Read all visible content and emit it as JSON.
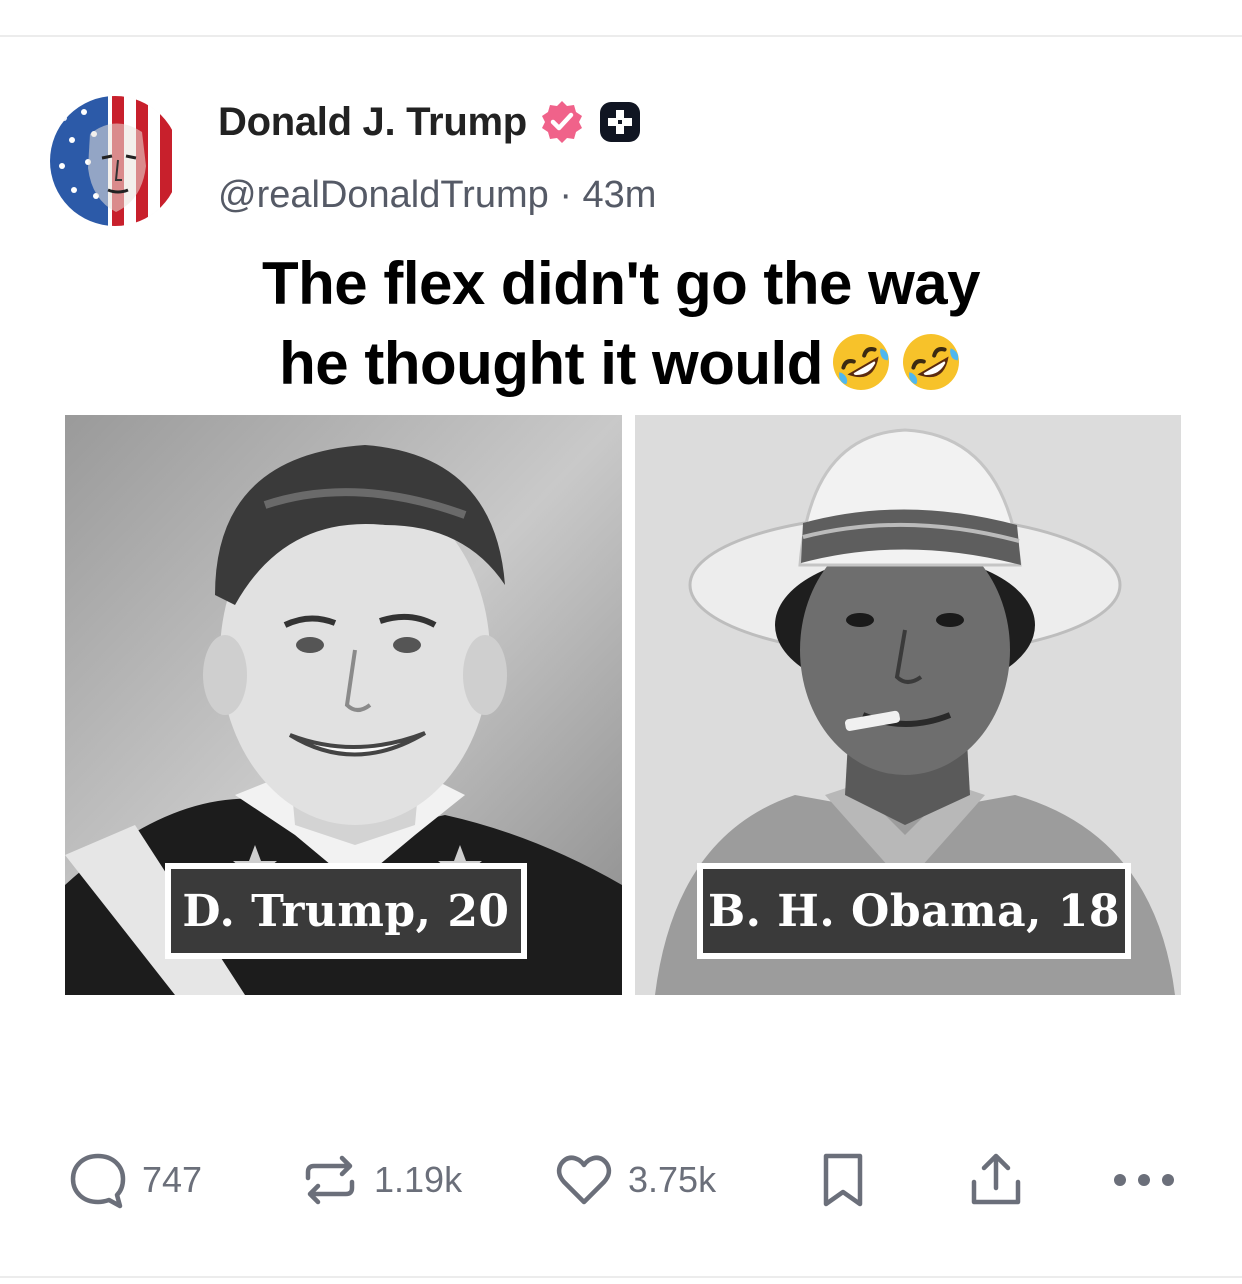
{
  "post": {
    "author": {
      "display_name": "Donald J. Trump",
      "handle": "@realDonaldTrump",
      "separator": "·",
      "time_ago": "43m",
      "avatar_icon": "flag-portrait-avatar",
      "verified_icon": "verified-badge-icon",
      "badge_icon": "plus-badge-icon",
      "verified_color": "#f0628a"
    },
    "caption": {
      "line1": "The flex didn't go the way",
      "line2": "he thought it would",
      "emojis": [
        "rolling-on-floor-laughing-emoji",
        "rolling-on-floor-laughing-emoji"
      ]
    },
    "images": [
      {
        "label": "D. Trump, 20",
        "name": "trump-photo"
      },
      {
        "label": "B. H. Obama, 18",
        "name": "obama-photo"
      }
    ],
    "actions": {
      "replies": "747",
      "reposts": "1.19k",
      "likes": "3.75k",
      "bookmark_icon": "bookmark-icon",
      "share_icon": "share-icon",
      "more_icon": "more-options-icon"
    }
  }
}
